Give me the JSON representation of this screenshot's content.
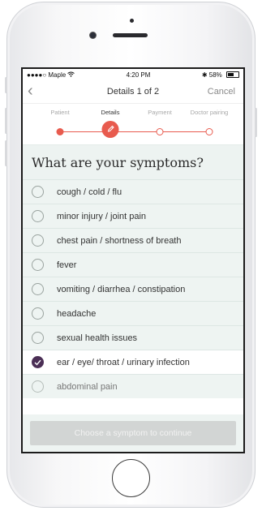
{
  "status_bar": {
    "carrier": "●●●●○ Maple",
    "wifi_icon": "wifi-icon",
    "time": "4:20 PM",
    "bluetooth_icon": "bluetooth-icon",
    "battery": "58%"
  },
  "nav": {
    "back_icon": "chevron-left-icon",
    "title": "Details 1 of 2",
    "cancel_label": "Cancel"
  },
  "stepper": {
    "steps": [
      {
        "label": "Patient",
        "state": "done"
      },
      {
        "label": "Details",
        "state": "current",
        "icon": "pencil-icon"
      },
      {
        "label": "Payment",
        "state": "pending"
      },
      {
        "label": "Doctor pairing",
        "state": "pending"
      }
    ],
    "accent": "#e85b4e"
  },
  "question": "What are your symptoms?",
  "symptoms": [
    {
      "label": "cough / cold / flu",
      "checked": false
    },
    {
      "label": "minor injury / joint pain",
      "checked": false
    },
    {
      "label": "chest pain / shortness of breath",
      "checked": false
    },
    {
      "label": "fever",
      "checked": false
    },
    {
      "label": "vomiting / diarrhea / constipation",
      "checked": false
    },
    {
      "label": "headache",
      "checked": false
    },
    {
      "label": "sexual health issues",
      "checked": false
    },
    {
      "label": "ear / eye/ throat / urinary infection",
      "checked": true
    },
    {
      "label": "abdominal pain",
      "checked": false
    }
  ],
  "cta_label": "Choose a symptom to continue",
  "colors": {
    "checked": "#4b2f55",
    "list_bg": "#eef4f2",
    "cta_bg": "#d2d5d4"
  }
}
